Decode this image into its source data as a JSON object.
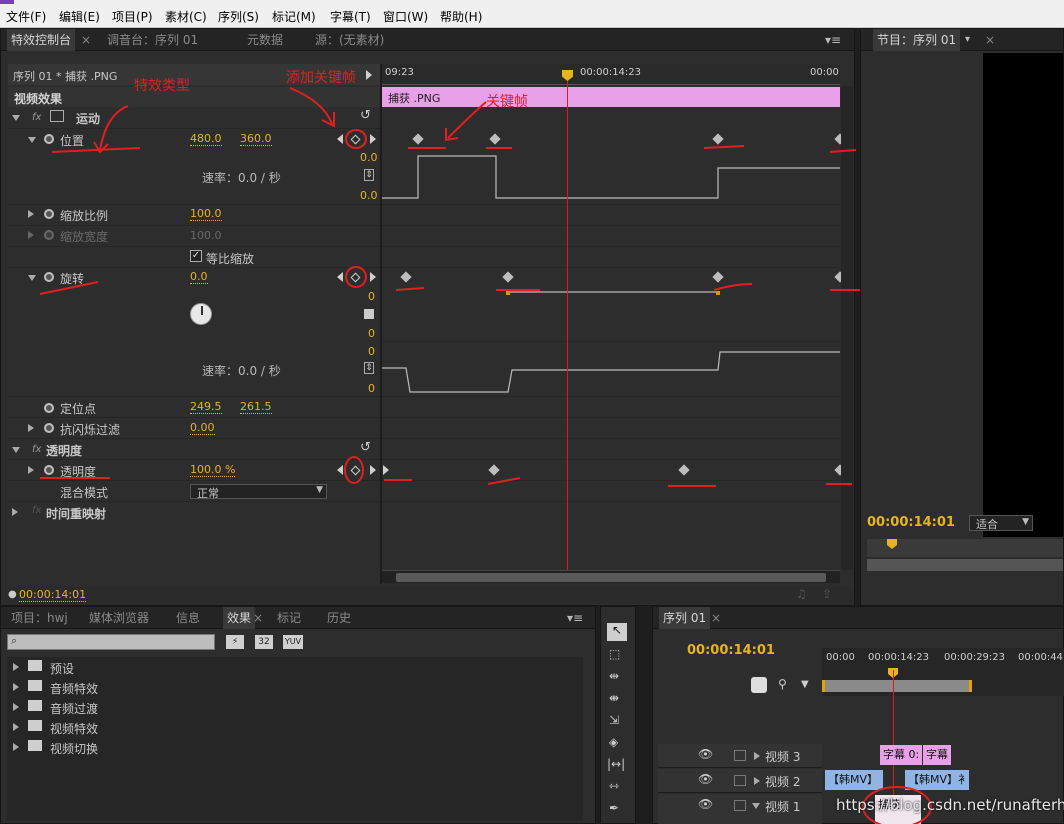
{
  "menu": [
    "文件(F)",
    "编辑(E)",
    "项目(P)",
    "素材(C)",
    "序列(S)",
    "标记(M)",
    "字幕(T)",
    "窗口(W)",
    "帮助(H)"
  ],
  "effect_panel": {
    "tabs": [
      "特效控制台",
      "调音台：序列 01",
      "元数据",
      "源：(无素材)"
    ],
    "clip_title": "序列 01 * 捕获 .PNG",
    "section_header": "视频效果",
    "ruler_start": "09:23",
    "ruler_mid": "00:00:14:23",
    "ruler_end": "00:00",
    "clip_bar_label": "捕获 .PNG",
    "motion_label": "运动",
    "position": {
      "label": "位置",
      "x": "480.0",
      "y": "360.0",
      "top_value": "0.0",
      "bottom_value": "0.0",
      "velocity": "速率：0.0 / 秒"
    },
    "scale": {
      "label": "缩放比例",
      "value": "100.0"
    },
    "scale_width": {
      "label": "缩放宽度",
      "value": "100.0"
    },
    "uniform_scale": "等比缩放",
    "rotation": {
      "label": "旋转",
      "value": "0.0",
      "v1": "0",
      "v2": "0",
      "v3": "0",
      "v4": "0",
      "velocity": "速率：0.0 / 秒"
    },
    "anchor": {
      "label": "定位点",
      "x": "249.5",
      "y": "261.5"
    },
    "antiflicker": {
      "label": "抗闪烁过滤",
      "value": "0.00"
    },
    "opacity_group": "透明度",
    "opacity": {
      "label": "透明度",
      "value": "100.0 %"
    },
    "blend_mode": {
      "label": "混合模式",
      "value": "正常"
    },
    "time_remap": "时间重映射",
    "footer_time": "00:00:14:01"
  },
  "annotations": {
    "effect_type": "特效类型",
    "add_keyframe": "添加关键帧",
    "keyframe": "关键帧"
  },
  "program_panel": {
    "tab": "节目：序列 01",
    "timecode": "00:00:14:01",
    "fit": "适合"
  },
  "project_panel": {
    "tabs": [
      "项目：hwj",
      "媒体浏览器",
      "信息",
      "效果",
      "标记",
      "历史"
    ],
    "search_placeholder": "",
    "badges": [
      "32",
      "YUV"
    ],
    "folders": [
      "预设",
      "音频特效",
      "音频过渡",
      "视频特效",
      "视频切换"
    ]
  },
  "sequence_panel": {
    "tab": "序列 01",
    "timecode": "00:00:14:01",
    "ruler": [
      "00:00",
      "00:00:14:23",
      "00:00:29:23",
      "00:00:44"
    ],
    "tracks": [
      "视频 3",
      "视频 2",
      "视频 1"
    ],
    "clips_v3": [
      "字幕 0:",
      "字幕"
    ],
    "clips_v2": [
      "【韩MV】",
      "【韩MV】衤"
    ],
    "clip_v1": "捕获"
  },
  "watermark": "https://blog.csdn.net/runafterhit",
  "colors": {
    "accent": "#e6b422",
    "clip_pink": "#e8a0e8",
    "clip_blue": "#8fb4e6",
    "annotation": "#e02020",
    "playhead": "#d02020"
  }
}
